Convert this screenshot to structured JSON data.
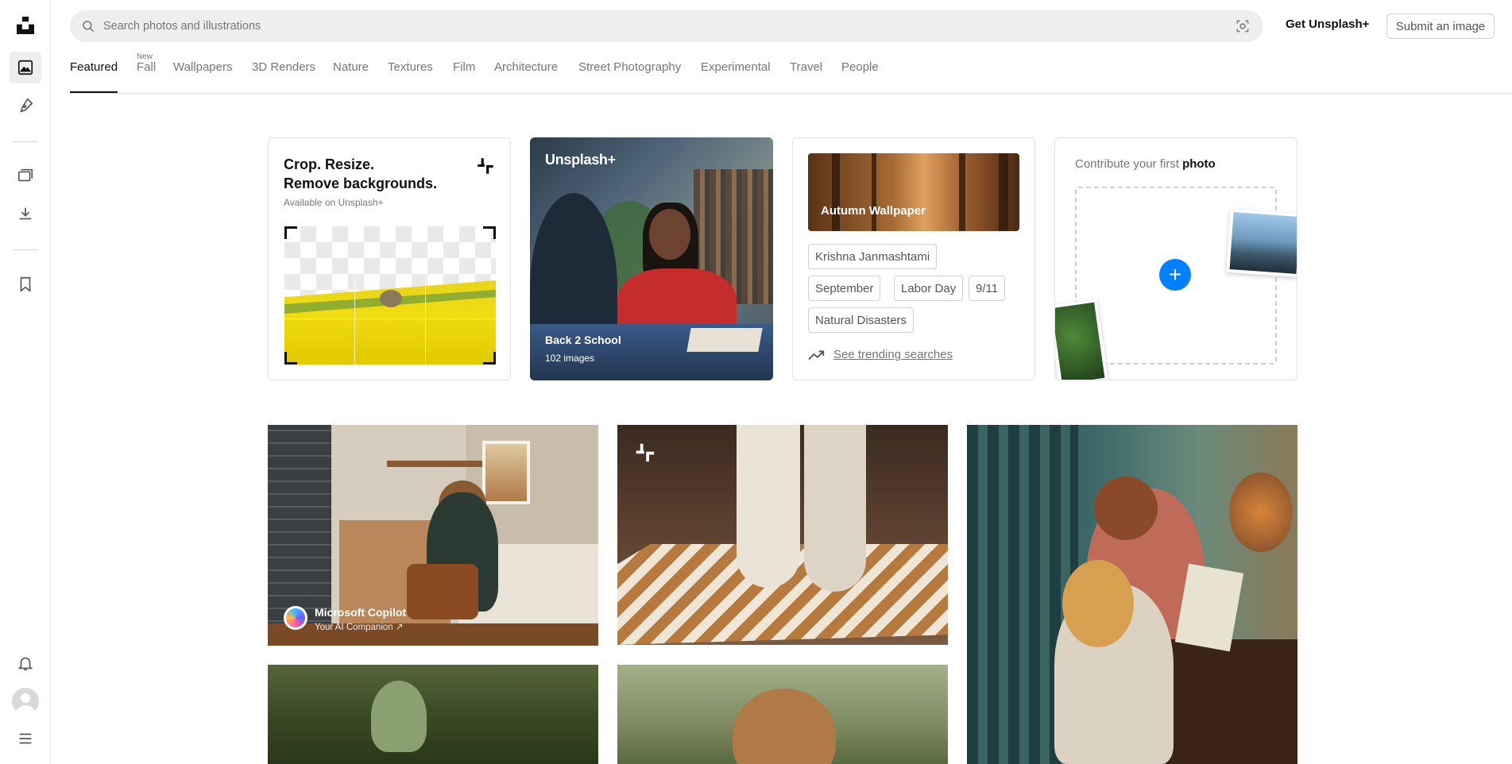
{
  "rail": {
    "items": [
      "unsplash-logo",
      "photos",
      "illustrations",
      "collections",
      "downloads",
      "bookmarks",
      "notifications",
      "account",
      "menu"
    ]
  },
  "search": {
    "placeholder": "Search photos and illustrations"
  },
  "header": {
    "get_plus": "Get Unsplash+",
    "submit": "Submit an image"
  },
  "tabs": [
    {
      "label": "Featured",
      "active": true
    },
    {
      "label": "Fall",
      "badge": "New"
    },
    {
      "label": "Wallpapers"
    },
    {
      "label": "3D Renders"
    },
    {
      "label": "Nature"
    },
    {
      "label": "Textures"
    },
    {
      "label": "Film"
    },
    {
      "label": "Architecture"
    },
    {
      "label": "Street Photography"
    },
    {
      "label": "Experimental"
    },
    {
      "label": "Travel"
    },
    {
      "label": "People"
    }
  ],
  "card_crop": {
    "line1": "Crop. Resize.",
    "line2": "Remove backgrounds.",
    "sub": "Available on Unsplash+"
  },
  "card_collection": {
    "logo": "Unsplash+",
    "title": "Back 2 School",
    "count": "102 images"
  },
  "card_trending": {
    "banner": "Autumn Wallpaper",
    "chips": [
      "Krishna Janmashtami",
      "September",
      "Labor Day",
      "9/11",
      "Natural Disasters"
    ],
    "link": "See trending searches"
  },
  "card_contribute": {
    "title_pre": "Contribute your first",
    "title_bold": "photo"
  },
  "sponsor": {
    "name": "Microsoft Copilot",
    "sub": "Your AI Companion ↗"
  },
  "colors": {
    "accent": "#007fff",
    "text": "#111111",
    "muted": "#767676"
  }
}
